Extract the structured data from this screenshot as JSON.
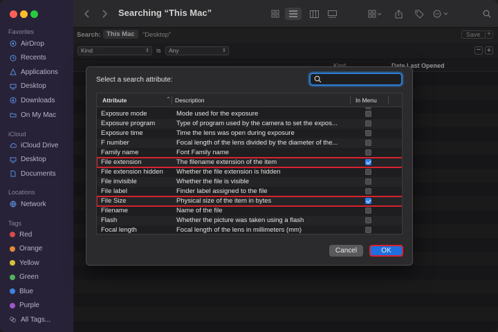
{
  "window": {
    "title": "Searching “This Mac”"
  },
  "colors": {
    "accent": "#1f6fe0",
    "highlight": "#d8232e",
    "sidebar": "#3a3050"
  },
  "sidebar": {
    "favorites_label": "Favorites",
    "favorites": [
      {
        "label": "AirDrop",
        "icon": "airdrop-icon"
      },
      {
        "label": "Recents",
        "icon": "clock-icon"
      },
      {
        "label": "Applications",
        "icon": "applications-icon"
      },
      {
        "label": "Desktop",
        "icon": "desktop-icon"
      },
      {
        "label": "Downloads",
        "icon": "download-icon"
      },
      {
        "label": "On My Mac",
        "icon": "folder-icon"
      }
    ],
    "icloud_label": "iCloud",
    "icloud": [
      {
        "label": "iCloud Drive",
        "icon": "cloud-icon"
      },
      {
        "label": "Desktop",
        "icon": "desktop-icon"
      },
      {
        "label": "Documents",
        "icon": "document-icon"
      }
    ],
    "locations_label": "Locations",
    "locations": [
      {
        "label": "Network",
        "icon": "globe-icon"
      }
    ],
    "tags_label": "Tags",
    "tags": [
      {
        "label": "Red",
        "color": "#d64b4b"
      },
      {
        "label": "Orange",
        "color": "#e08a3b"
      },
      {
        "label": "Yellow",
        "color": "#d9c13c"
      },
      {
        "label": "Green",
        "color": "#4fb35b"
      },
      {
        "label": "Blue",
        "color": "#3b82e0"
      },
      {
        "label": "Purple",
        "color": "#9b59c7"
      },
      {
        "label": "All Tags...",
        "color": ""
      }
    ]
  },
  "search": {
    "label": "Search:",
    "scope_this_mac": "This Mac",
    "scope_desktop": "“Desktop”",
    "save_label": "Save",
    "rule_attribute": "Kind",
    "rule_operator": "is",
    "rule_value": "Any"
  },
  "list": {
    "col_kind": "Kind",
    "col_date": "Date Last Opened"
  },
  "dialog": {
    "prompt": "Select a search attribute:",
    "search_placeholder": "",
    "headers": {
      "attribute": "Attribute",
      "description": "Description",
      "in_menu": "In Menu"
    },
    "rows": [
      {
        "attribute": "Exposure mode",
        "description": "Mode used for the exposure",
        "checked": false,
        "highlight": false
      },
      {
        "attribute": "Exposure program",
        "description": "Type of program used by the camera to set the expos...",
        "checked": false,
        "highlight": false
      },
      {
        "attribute": "Exposure time",
        "description": "Time the lens was open during exposure",
        "checked": false,
        "highlight": false
      },
      {
        "attribute": "F number",
        "description": "Focal length of the lens divided by the diameter of the...",
        "checked": false,
        "highlight": false
      },
      {
        "attribute": "Family name",
        "description": "Font Family name",
        "checked": false,
        "highlight": false
      },
      {
        "attribute": "File extension",
        "description": "The filename extension of the item",
        "checked": true,
        "highlight": true
      },
      {
        "attribute": "File extension hidden",
        "description": "Whether the file extension is hidden",
        "checked": false,
        "highlight": false
      },
      {
        "attribute": "File invisible",
        "description": "Whether the file is visible",
        "checked": false,
        "highlight": false
      },
      {
        "attribute": "File label",
        "description": "Finder label assigned to the file",
        "checked": false,
        "highlight": false
      },
      {
        "attribute": "File Size",
        "description": "Physical size of the item in bytes",
        "checked": true,
        "highlight": true
      },
      {
        "attribute": "Filename",
        "description": "Name of the file",
        "checked": false,
        "highlight": false
      },
      {
        "attribute": "Flash",
        "description": "Whether the picture was taken using a flash",
        "checked": false,
        "highlight": false
      },
      {
        "attribute": "Focal length",
        "description": "Focal length of the lens in millimeters (mm)",
        "checked": false,
        "highlight": false
      }
    ],
    "cancel_label": "Cancel",
    "ok_label": "OK"
  }
}
